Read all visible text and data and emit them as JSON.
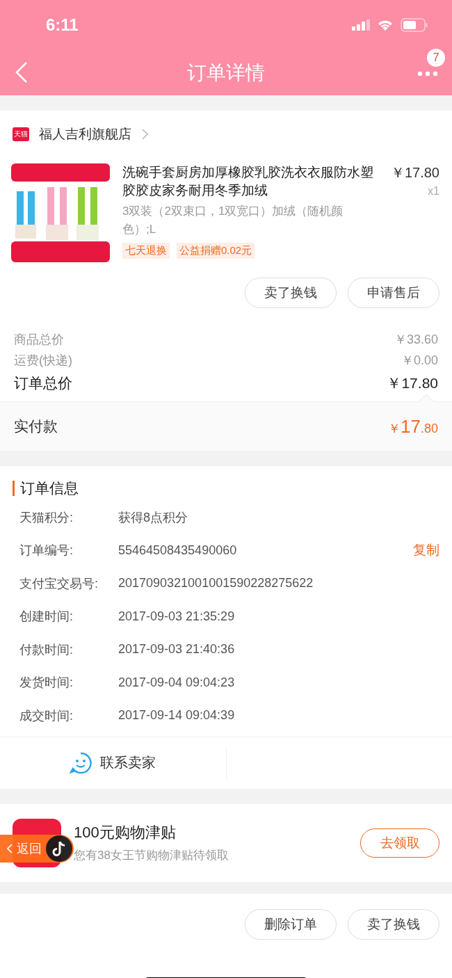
{
  "status_bar": {
    "time": "6:11"
  },
  "nav": {
    "title": "订单详情",
    "badge": "7"
  },
  "store": {
    "name": "福人吉利旗舰店",
    "logo": "天猫"
  },
  "product": {
    "title": "洗碗手套厨房加厚橡胶乳胶洗衣衣服防水塑胶胶皮家务耐用冬季加绒",
    "price": "￥17.80",
    "quantity": "x1",
    "spec": "3双装（2双束口，1双宽口）加绒（随机颜色）;L",
    "tags": [
      "七天退换",
      "公益捐赠0.02元"
    ],
    "buttons": [
      "卖了换钱",
      "申请售后"
    ]
  },
  "totals": [
    {
      "label": "商品总价",
      "value": "￥33.60",
      "kind": "minor"
    },
    {
      "label": "运费(快递)",
      "value": "￥0.00",
      "kind": "minor"
    },
    {
      "label": "订单总价",
      "value": "￥17.80",
      "kind": "major"
    }
  ],
  "paid": {
    "label": "实付款",
    "currency": "￥",
    "integer": "17",
    "decimal": ".80"
  },
  "order_info": {
    "title": "订单信息",
    "rows": [
      {
        "label": "天猫积分:",
        "value": "获得8点积分"
      },
      {
        "label": "订单编号:",
        "value": "55464508435490060",
        "action": "复制"
      },
      {
        "label": "支付宝交易号:",
        "value": "2017090321001001590228275622"
      },
      {
        "label": "创建时间:",
        "value": "2017-09-03 21:35:29"
      },
      {
        "label": "付款时间:",
        "value": "2017-09-03 21:40:36"
      },
      {
        "label": "发货时间:",
        "value": "2017-09-04 09:04:23"
      },
      {
        "label": "成交时间:",
        "value": "2017-09-14 09:04:39"
      }
    ],
    "contact": "联系卖家"
  },
  "promo": {
    "title": "100元购物津贴",
    "subtitle": "您有38女王节购物津贴待领取",
    "button": "去领取"
  },
  "floating_back": {
    "label": "返回"
  },
  "bottom_buttons": [
    "删除订单",
    "卖了换钱"
  ]
}
